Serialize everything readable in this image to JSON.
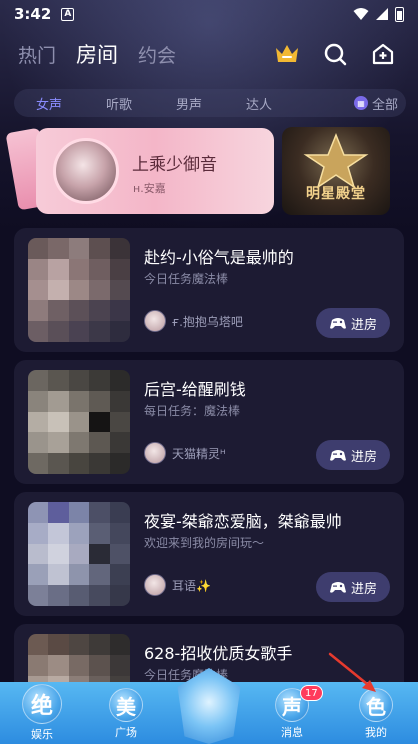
{
  "status_bar": {
    "time": "3:42",
    "notif_letter": "A"
  },
  "top_nav": {
    "tabs": [
      {
        "label": "热门",
        "active": false
      },
      {
        "label": "房间",
        "active": true
      },
      {
        "label": "约会",
        "active": false
      }
    ],
    "icons": [
      "crown-icon",
      "search-icon",
      "add-room-icon"
    ]
  },
  "filters": {
    "items": [
      {
        "label": "女声",
        "active": true
      },
      {
        "label": "听歌",
        "active": false
      },
      {
        "label": "男声",
        "active": false
      },
      {
        "label": "达人",
        "active": false
      }
    ],
    "all_label": "全部",
    "accent": "#8a8cff"
  },
  "banners": {
    "featured": {
      "title": "上乘少御音",
      "host": "н.安嘉"
    },
    "star_hall": {
      "label": "明星殿堂"
    }
  },
  "rooms": [
    {
      "title": "赴约-小俗气是最帅的",
      "subtitle": "今日任务魔法棒",
      "host": "ғ.抱抱乌塔吧",
      "enter": "进房"
    },
    {
      "title": "后宫-给醒刷钱",
      "subtitle": "每日任务：魔法棒",
      "host": "天猫精灵ᴴ",
      "enter": "进房"
    },
    {
      "title": "夜宴-桀爺恋爱脑，桀爺最帅",
      "subtitle": "欢迎来到我的房间玩～",
      "host": "耳语✨",
      "enter": "进房"
    },
    {
      "title": "628-招收优质女歌手",
      "subtitle": "今日任务魔法棒",
      "host": "",
      "enter": ""
    }
  ],
  "bottom_nav": {
    "items": [
      {
        "glyph": "绝",
        "label": "娱乐"
      },
      {
        "glyph": "美",
        "label": "广场"
      },
      {
        "glyph": "声",
        "label": "消息",
        "badge": "17"
      },
      {
        "glyph": "色",
        "label": "我的"
      }
    ],
    "bar_color": "#3a9ae6"
  }
}
